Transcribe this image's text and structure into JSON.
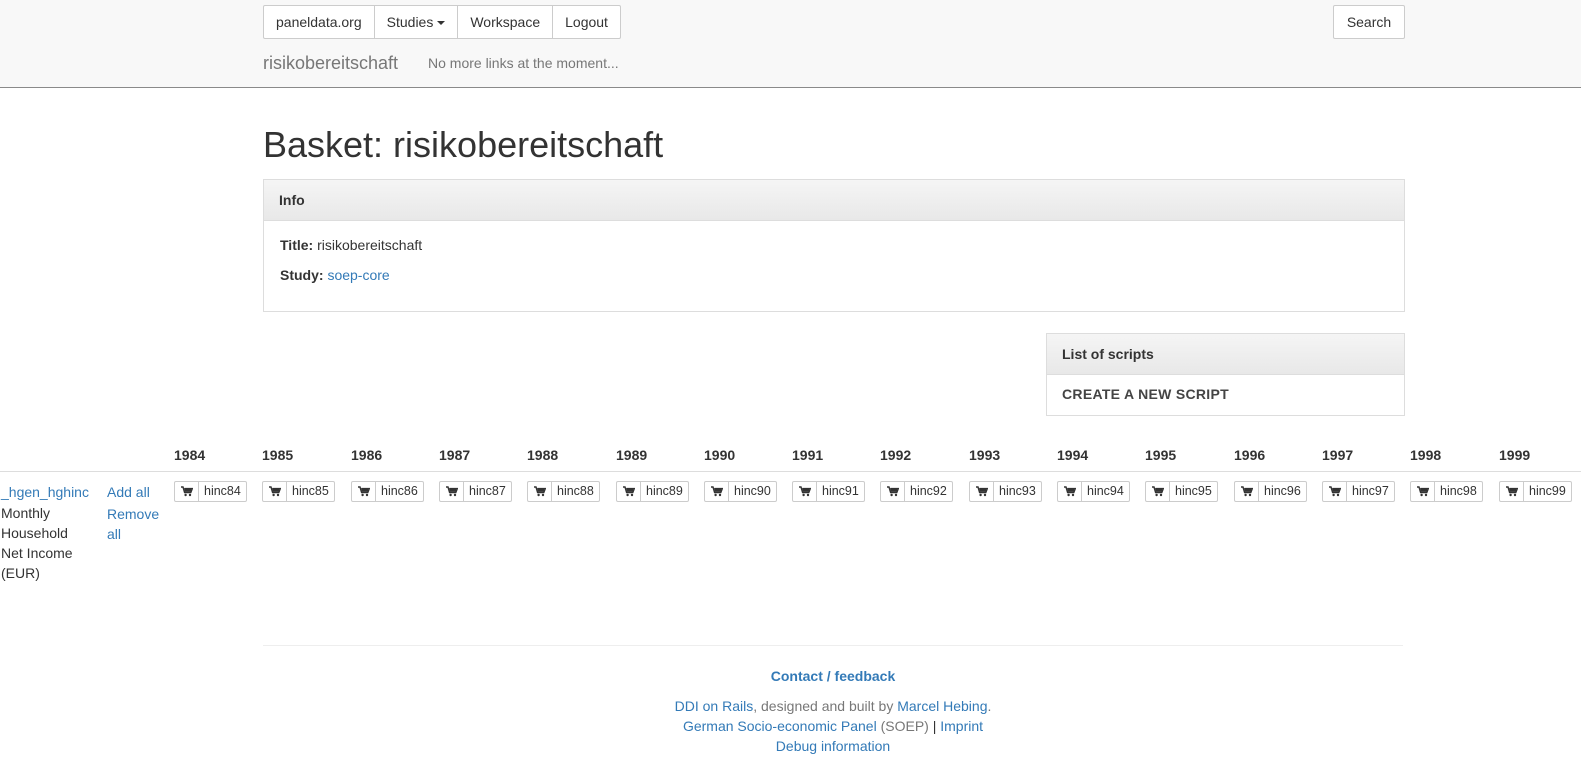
{
  "navbar": {
    "buttons": [
      "paneldata.org",
      "Studies",
      "Workspace",
      "Logout"
    ],
    "search_label": "Search",
    "brand": "risikobereitschaft",
    "note": "No more links at the moment..."
  },
  "page": {
    "title": "Basket: risikobereitschaft"
  },
  "info_panel": {
    "heading": "Info",
    "title_label": "Title:",
    "title_value": "risikobereitschaft",
    "study_label": "Study:",
    "study_value": "soep-core"
  },
  "scripts_panel": {
    "heading": "List of scripts",
    "create_label": "CREATE A NEW SCRIPT"
  },
  "variable_table": {
    "years": [
      "1984",
      "1985",
      "1986",
      "1987",
      "1988",
      "1989",
      "1990",
      "1991",
      "1992",
      "1993",
      "1994",
      "1995",
      "1996",
      "1997",
      "1998",
      "1999"
    ],
    "row": {
      "variable": "_hgen_hghinc",
      "label": "Monthly Household Net Income (EUR)",
      "add_all": "Add all",
      "remove_all": "Remove all",
      "cells": [
        "hinc84",
        "hinc85",
        "hinc86",
        "hinc87",
        "hinc88",
        "hinc89",
        "hinc90",
        "hinc91",
        "hinc92",
        "hinc93",
        "hinc94",
        "hinc95",
        "hinc96",
        "hinc97",
        "hinc98",
        "hinc99"
      ]
    }
  },
  "footer": {
    "contact": "Contact / feedback",
    "ddi_link": "DDI on Rails",
    "designed_text": ", designed and built by ",
    "author_link": "Marcel Hebing",
    "period": ".",
    "soep_link": "German Socio-economic Panel",
    "soep_abbr": " (SOEP) ",
    "pipe": "|",
    "imprint_link": " Imprint",
    "debug_link": "Debug information"
  },
  "icons": {
    "cart": "shopping-cart-icon",
    "caret": "caret-down-icon"
  },
  "colors": {
    "link": "#337ab7",
    "navbar_bg": "#f8f8f8",
    "border": "#dddddd"
  }
}
